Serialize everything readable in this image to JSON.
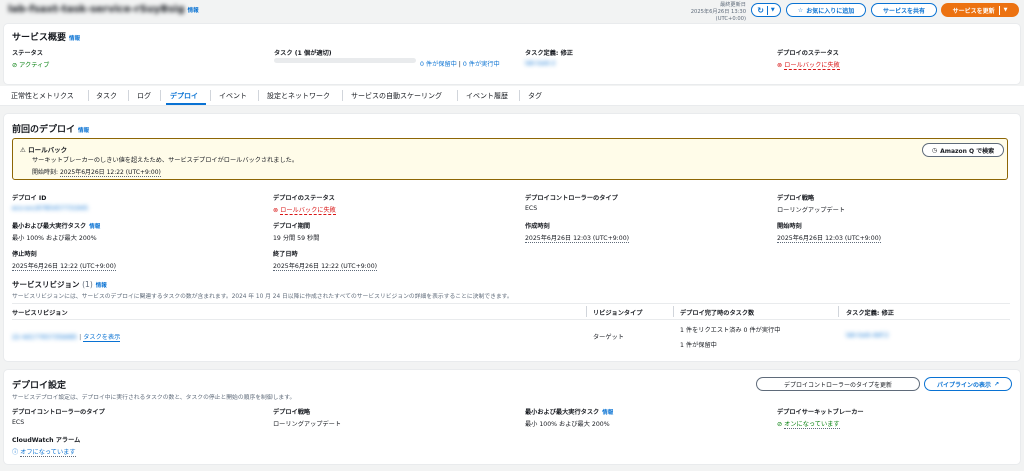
{
  "header": {
    "service_name": "lab-fsaxt-task-service-rSuyBsig",
    "info": "情報",
    "last_fetched_label": "最終更新日",
    "last_fetched_time": "2025年6月26日 13:30 (UTC+0:00)",
    "favorite_button": "お気に入りに追加",
    "share_button": "サービスを共有",
    "update_button": "サービスを更新"
  },
  "overview": {
    "title": "サービス概要",
    "info": "情報",
    "status_label": "ステータス",
    "status_value": "アクティブ",
    "tasks_label": "タスク (1 個が適切)",
    "tasks_pending": "0 件が保留中",
    "tasks_running": "0 件が実行中",
    "taskdef_label": "タスク定義: 修正",
    "taskdef_value": "lab-task:2",
    "deploy_status_label": "デプロイのステータス",
    "deploy_status_value": "ロールバックに失敗",
    "tasks_progress": 0.0
  },
  "tabs": [
    "正常性とメトリクス",
    "タスク",
    "ログ",
    "デプロイ",
    "イベント",
    "設定とネットワーク",
    "サービスの自動スケーリング",
    "イベント履歴",
    "タグ"
  ],
  "active_tab": 3,
  "prev_deploy": {
    "title": "前回のデプロイ",
    "info": "情報",
    "alert_title": "ロールバック",
    "alert_message": "サーキットブレーカーのしきい値を超えたため、サービスデプロイがロールバックされました。",
    "alert_time_label": "開始時刻:",
    "alert_time": "2025年6月26日 12:22 (UTC+9:00)",
    "amazon_q_button": "Amazon Q で検索",
    "fields": {
      "deploy_id_label": "デプロイ ID",
      "deploy_id_value": "ecs-svc/6785457731945",
      "deploy_status_label": "デプロイのステータス",
      "deploy_status_value": "ロールバックに失敗",
      "controller_label": "デプロイコントローラーのタイプ",
      "controller_value": "ECS",
      "strategy_label": "デプロイ戦略",
      "strategy_value": "ローリングアップデート",
      "minmax_label": "最小および最大実行タスク",
      "minmax_info": "情報",
      "minmax_value": "最小 100% および最大 200%",
      "duration_label": "デプロイ期間",
      "duration_value": "19 分間 59 秒間",
      "created_label": "作成時刻",
      "created_value": "2025年6月26日 12:03 (UTC+9:00)",
      "start_label": "開始時刻",
      "start_value": "2025年6月26日 12:03 (UTC+9:00)",
      "stop_label": "停止時刻",
      "stop_value": "2025年6月26日 12:22 (UTC+9:00)",
      "end_label": "終了日時",
      "end_value": "2025年6月26日 12:22 (UTC+9:00)"
    },
    "revisions_title": "サービスリビジョン",
    "revisions_count": "(1)",
    "revisions_info": "情報",
    "revisions_desc": "サービスリビジョンには、サービスのデプロイに関連するタスクの数が含まれます。2024 年 10 月 24 日以降に作成されたすべてのサービスリビジョンの詳細を表示することに決制できます。",
    "table_headers": [
      "サービスリビジョン",
      "リビジョンタイプ",
      "デプロイ完了時のタスク数",
      "タスク定義: 修正"
    ],
    "row": {
      "revision": "22-4d17765735b685",
      "view_tasks": "タスクを表示",
      "type": "ターゲット",
      "tasks_line1": "1 件をリクエスト済み  0 件が実行中",
      "tasks_line2": "1 件が保留中",
      "taskdef": "lab-task-def:2"
    }
  },
  "deploy_settings": {
    "title": "デプロイ設定",
    "desc": "サービスデプロイ設定は、デプロイ中に実行されるタスクの数と、タスクの停止と開始の順序を制御します。",
    "update_controller_button": "デプロイコントローラーのタイプを更新",
    "view_pipeline_button": "パイプラインの表示",
    "controller_label": "デプロイコントローラーのタイプ",
    "controller_value": "ECS",
    "strategy_label": "デプロイ戦略",
    "strategy_value": "ローリングアップデート",
    "minmax_label": "最小および最大実行タスク",
    "minmax_info": "情報",
    "minmax_value": "最小 100% および最大 200%",
    "breaker_label": "デプロイサーキットブレーカー",
    "breaker_value": "オンになっています",
    "alarm_label": "CloudWatch アラーム",
    "alarm_value": "オフになっています"
  }
}
